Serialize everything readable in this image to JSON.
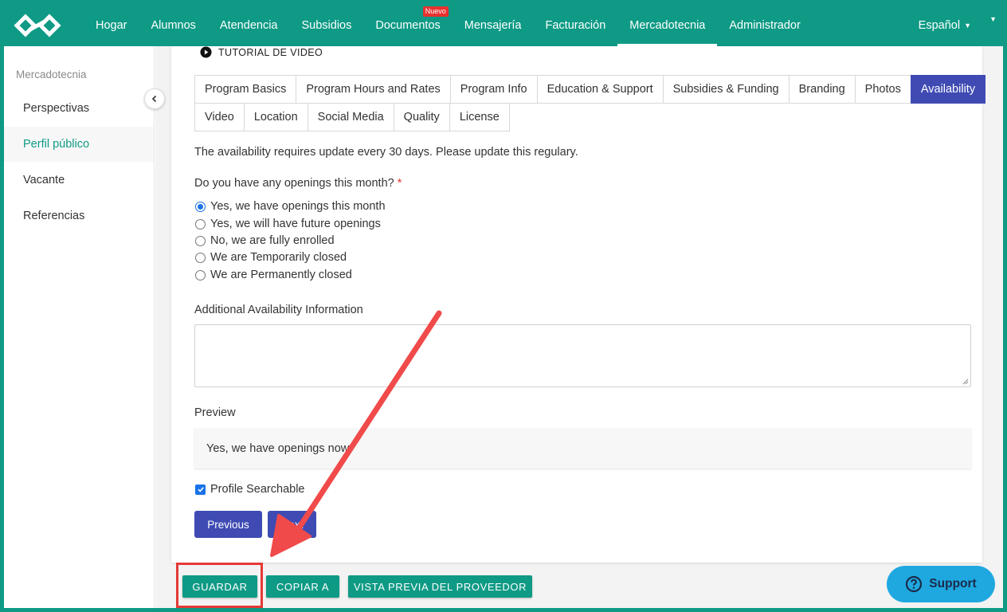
{
  "nav": {
    "items": [
      {
        "label": "Hogar"
      },
      {
        "label": "Alumnos"
      },
      {
        "label": "Atendencia"
      },
      {
        "label": "Subsidios"
      },
      {
        "label": "Documentos",
        "badge": "Nuevo"
      },
      {
        "label": "Mensajería"
      },
      {
        "label": "Facturación"
      },
      {
        "label": "Mercadotecnia",
        "active": true
      },
      {
        "label": "Administrador"
      }
    ],
    "language": "Español"
  },
  "sidebar": {
    "title": "Mercadotecnia",
    "items": [
      {
        "label": "Perspectivas"
      },
      {
        "label": "Perfil público",
        "active": true
      },
      {
        "label": "Vacante"
      },
      {
        "label": "Referencias"
      }
    ]
  },
  "tutorial_label": "TUTORIAL DE VIDEO",
  "tabs_row1": [
    "Program Basics",
    "Program Hours and Rates",
    "Program Info",
    "Education & Support",
    "Subsidies & Funding",
    "Branding",
    "Photos",
    "Availability"
  ],
  "tabs_row2": [
    "Video",
    "Location",
    "Social Media",
    "Quality",
    "License"
  ],
  "active_tab": "Availability",
  "notice": "The availability requires update every 30 days. Please update this regulary.",
  "question": "Do you have any openings this month?",
  "required_mark": "*",
  "options": [
    {
      "label": "Yes, we have openings this month",
      "checked": true
    },
    {
      "label": "Yes, we will have future openings",
      "checked": false
    },
    {
      "label": "No, we are fully enrolled",
      "checked": false
    },
    {
      "label": "We are Temporarily closed",
      "checked": false
    },
    {
      "label": "We are Permanently closed",
      "checked": false
    }
  ],
  "additional_label": "Additional Availability Information",
  "additional_value": "",
  "preview_label": "Preview",
  "preview_text": "Yes, we have openings now",
  "searchable_label": "Profile Searchable",
  "searchable_checked": true,
  "buttons": {
    "previous": "Previous",
    "next": "Next",
    "save": "GUARDAR",
    "copy": "COPIAR A",
    "preview_provider": "VISTA PREVIA DEL PROVEEDOR"
  },
  "support_label": "Support",
  "colors": {
    "brand": "#0e9a85",
    "active_tab": "#3f4bb3",
    "annotation": "#e53935",
    "support": "#1fa8e0"
  }
}
